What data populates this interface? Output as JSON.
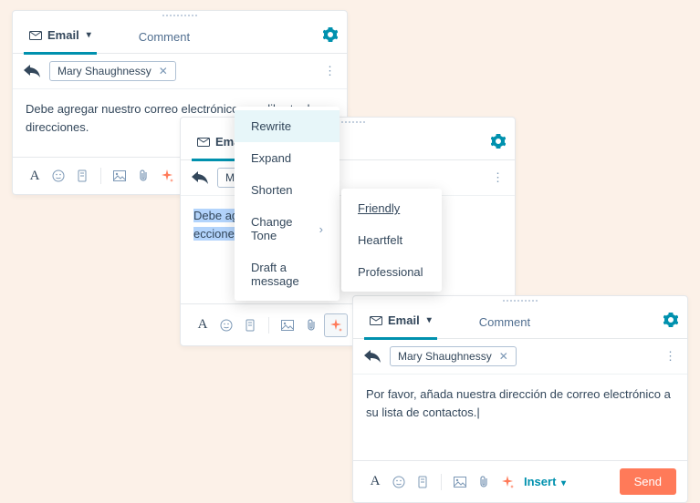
{
  "tabs": {
    "email_label": "Email",
    "comment_label": "Comment"
  },
  "recipient": {
    "name": "Mary Shaughnessy"
  },
  "bodies": {
    "p1": "Debe agregar nuestro correo electrónico a su libreta de direcciones.",
    "p2_prefix": "Debe agreg",
    "p2_suffix": "ecciones.",
    "p3": "Por favor, añada nuestra dirección de correo electrónico a su lista de contactos."
  },
  "toolbar": {
    "insert_label": "Insert",
    "send_label": "Send"
  },
  "ai_menu": {
    "rewrite": "Rewrite",
    "expand": "Expand",
    "shorten": "Shorten",
    "change_tone": "Change Tone",
    "draft": "Draft a message"
  },
  "tone_menu": {
    "friendly": "Friendly",
    "heartfelt": "Heartfelt",
    "professional": "Professional"
  }
}
